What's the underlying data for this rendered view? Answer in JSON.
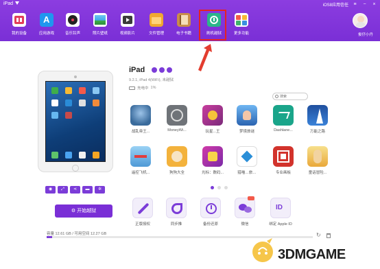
{
  "window": {
    "title": "iPad",
    "user_status": "iOS8应用信任"
  },
  "toolbar": [
    {
      "label": "我的设备",
      "icon": "device-icon",
      "color": "#e33d5a"
    },
    {
      "label": "应用游戏",
      "icon": "app-store-icon",
      "color": "#1f97ef"
    },
    {
      "label": "音乐铃声",
      "icon": "music-icon",
      "color": "#222222"
    },
    {
      "label": "照片壁纸",
      "icon": "photo-icon",
      "color": "#41a8e8"
    },
    {
      "label": "视频影片",
      "icon": "video-icon",
      "color": "#3a3a3a"
    },
    {
      "label": "文件管理",
      "icon": "folder-icon",
      "color": "#f0a830"
    },
    {
      "label": "电子书籍",
      "icon": "book-icon",
      "color": "#c98d4a"
    },
    {
      "label": "刷机越狱",
      "icon": "flash-jailbreak-icon",
      "color": "#2bb68a"
    },
    {
      "label": "更多功能",
      "icon": "more-icon",
      "color": "#f35a4a"
    }
  ],
  "user": {
    "name": "俊仔小丹"
  },
  "device": {
    "name": "iPad",
    "details": "9.2.1, iPad 4(WiFi), 未越狱",
    "battery_label": "充电中",
    "battery_percent": "1%"
  },
  "search": {
    "placeholder": "搜索"
  },
  "apps": [
    {
      "label": "战乱帝王...",
      "color": "#3a6b9c"
    },
    {
      "label": "MoneyWi...",
      "color": "#6f7378"
    },
    {
      "label": "玩星...王",
      "color": "#b24a8e"
    },
    {
      "label": "梦境旅谜",
      "color": "#3b7ed0"
    },
    {
      "label": "Dashlane...",
      "color": "#1aa58a"
    },
    {
      "label": "万能之路",
      "color": "#3264b8"
    },
    {
      "label": "遥控飞机...",
      "color": "#5aa4d8"
    },
    {
      "label": "狗狗大全",
      "color": "#f3b23c"
    },
    {
      "label": "光标：数码...",
      "color": "#c53aa0"
    },
    {
      "label": "猎喵…旅…",
      "color": "#2b8fd8"
    },
    {
      "label": "专业画板",
      "color": "#d2332c"
    },
    {
      "label": "童话冒险...",
      "color": "#f2d26a"
    }
  ],
  "pager": {
    "active_index": 0,
    "count": 3
  },
  "tools": [
    {
      "label": "正版授权",
      "icon": "wrench-icon"
    },
    {
      "label": "同步推",
      "icon": "sync-icon"
    },
    {
      "label": "备份还原",
      "icon": "backup-restore-icon"
    },
    {
      "label": "微信",
      "icon": "wechat-icon"
    },
    {
      "label": "绑定 Apple ID",
      "icon": "apple-id-icon"
    }
  ],
  "jailbreak_button": "开始越狱",
  "storage": {
    "label": "容量",
    "text": "12.61 GB / 可用空间",
    "free": "12.27 GB",
    "used_fraction": 0.02
  },
  "watermark": {
    "text": "3DMGAME"
  },
  "colors": {
    "brand": "#7a2fd6",
    "highlight": "#e52222"
  }
}
